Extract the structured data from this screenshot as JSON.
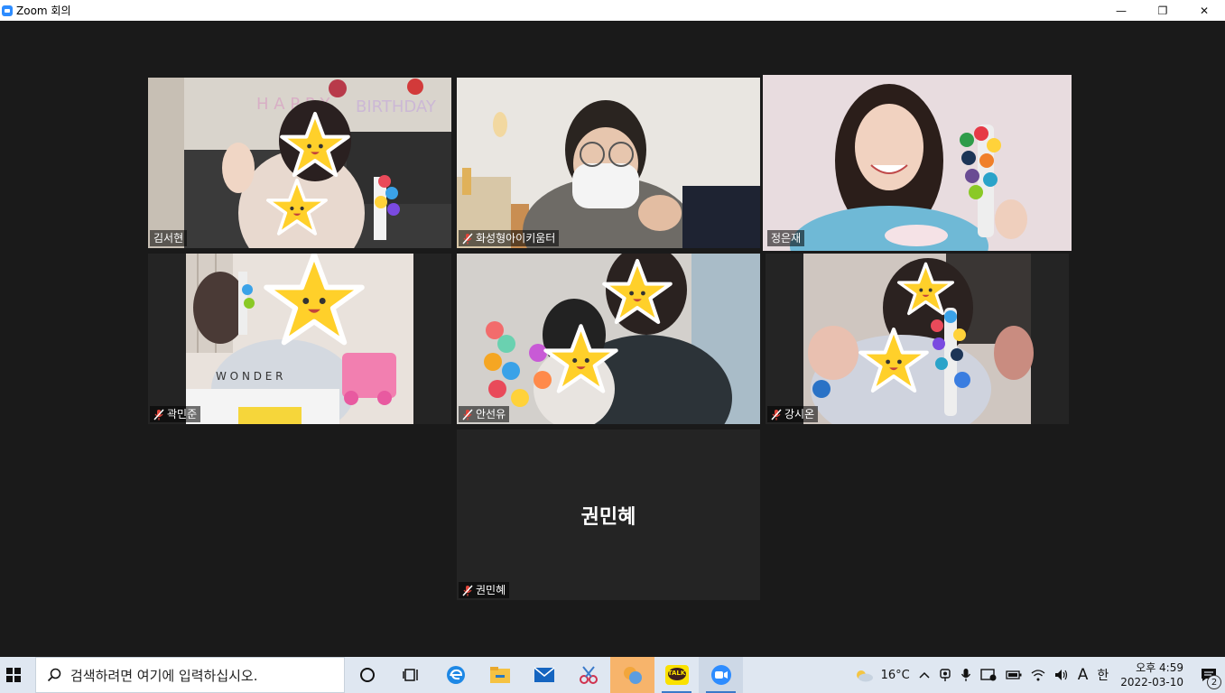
{
  "window": {
    "title": "Zoom 회의",
    "minimize_glyph": "—",
    "restore_glyph": "❐",
    "close_glyph": "✕"
  },
  "participants": [
    {
      "name": "김서현",
      "muted": false,
      "active_speaker": false,
      "video": true
    },
    {
      "name": "화성형아이키움터",
      "muted": true,
      "active_speaker": false,
      "video": true
    },
    {
      "name": "정은재",
      "muted": false,
      "active_speaker": true,
      "video": true
    },
    {
      "name": "곽민준",
      "muted": true,
      "active_speaker": false,
      "video": true
    },
    {
      "name": "안선유",
      "muted": true,
      "active_speaker": false,
      "video": true
    },
    {
      "name": "강시온",
      "muted": true,
      "active_speaker": false,
      "video": true
    },
    {
      "name": "권민혜",
      "muted": true,
      "active_speaker": false,
      "video": false,
      "display_name": "권민혜"
    }
  ],
  "taskbar": {
    "search_placeholder": "검색하려면 여기에 입력하십시오.",
    "apps": [
      "cortana-icon",
      "task-view-icon",
      "edge-icon",
      "file-explorer-icon",
      "mail-icon",
      "snip-icon",
      "photos-icon",
      "kakaotalk-icon",
      "zoom-icon"
    ],
    "kakaotalk_label": "TALK"
  },
  "tray": {
    "weather": "16°C",
    "ime_lang": "A",
    "ime_mode": "한",
    "time": "오후 4:59",
    "date": "2022-03-10",
    "notification_count": "2"
  },
  "colors": {
    "active_speaker_border": "#c8e24a",
    "zoom_blue": "#2d8cff",
    "taskbar_bg": "#dfe7f1",
    "mute_red": "#e0453a"
  }
}
